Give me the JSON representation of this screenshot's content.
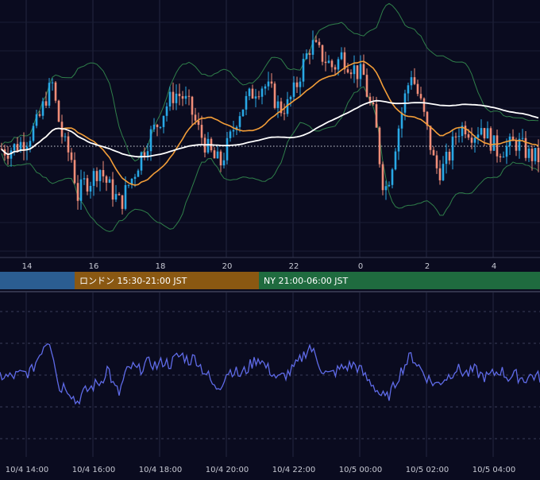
{
  "chart_data": [
    {
      "type": "candlestick",
      "title": "",
      "xlabel": "",
      "ylabel": "",
      "x_ticks": [
        "14",
        "16",
        "18",
        "20",
        "22",
        "0",
        "2",
        "4"
      ],
      "y_range": [
        0,
        100
      ],
      "grid": true,
      "series": [
        {
          "name": "",
          "kind": "candles",
          "up_color": "#29a9e6",
          "down_color": "#f08d78"
        },
        {
          "name": "",
          "kind": "moving-average-short",
          "color": "#f29d38"
        },
        {
          "name": "",
          "kind": "moving-average-long",
          "color": "#ffffff"
        },
        {
          "name": "",
          "kind": "bollinger-bands",
          "color": "#2f7f4a"
        }
      ],
      "reference_line": {
        "style": "dotted",
        "color": "#cfd2da"
      }
    },
    {
      "type": "line",
      "title": "",
      "xlabel": "",
      "ylabel": "",
      "x_ticks": [
        "10/4 14:00",
        "10/4 16:00",
        "10/4 18:00",
        "10/4 20:00",
        "10/4 22:00",
        "10/5 00:00",
        "10/5 02:00",
        "10/5 04:00"
      ],
      "y_range": [
        0,
        100
      ],
      "grid": true,
      "series": [
        {
          "name": "",
          "color": "#5f6be8"
        }
      ]
    }
  ],
  "sessions": [
    {
      "label": "",
      "color": "#2b5d91"
    },
    {
      "label": "ロンドン 15:30-21:00 JST",
      "color": "#8a5812"
    },
    {
      "label": "NY 21:00-06:00 JST",
      "color": "#1f6b3f"
    }
  ]
}
